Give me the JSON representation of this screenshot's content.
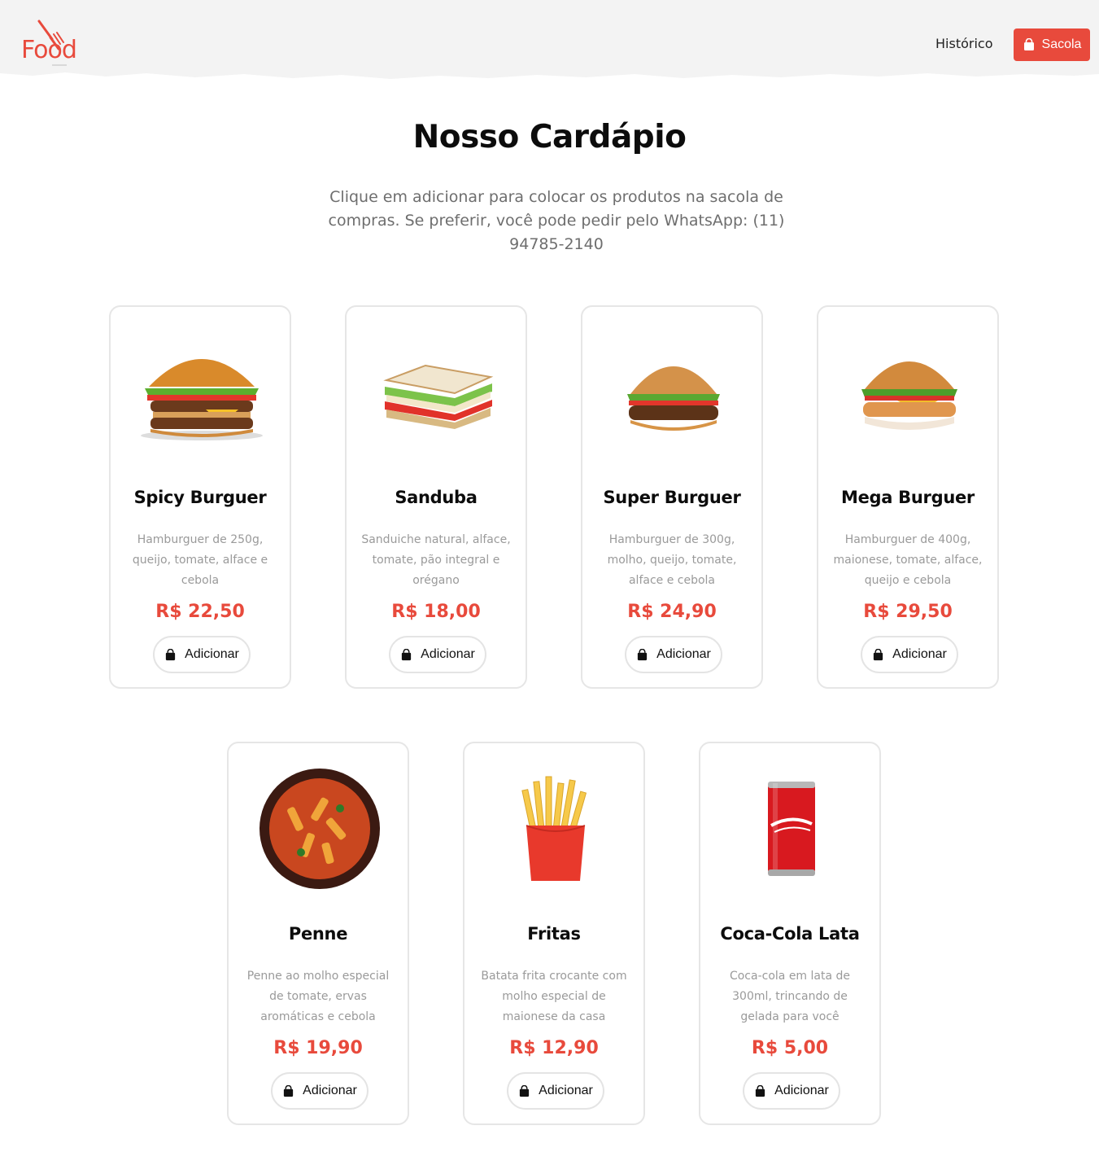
{
  "brand": {
    "logo_text": "Food",
    "accent_color": "#e84a3c"
  },
  "nav": {
    "history_label": "Histórico",
    "bag_label": "Sacola",
    "bag_icon": "shopping-bag-icon"
  },
  "menu": {
    "title": "Nosso Cardápio",
    "subtitle": "Clique em adicionar para colocar os produtos na sacola de compras. Se preferir, você pode pedir pelo WhatsApp: (11) 94785-2140"
  },
  "products": [
    {
      "name": "Spicy Burguer",
      "description": "Hamburguer de 250g, queijo, tomate, alface e cebola",
      "price": "R$ 22,50",
      "add_label": "Adicionar",
      "image": "double-burger-image"
    },
    {
      "name": "Sanduba",
      "description": "Sanduiche natural, alface, tomate, pão integral e orégano",
      "price": "R$ 18,00",
      "add_label": "Adicionar",
      "image": "sandwich-image"
    },
    {
      "name": "Super Burguer",
      "description": "Hamburguer de 300g, molho, queijo, tomate, alface e cebola",
      "price": "R$ 24,90",
      "add_label": "Adicionar",
      "image": "burger-image"
    },
    {
      "name": "Mega Burguer",
      "description": "Hamburguer de 400g, maionese, tomate, alface, queijo e cebola",
      "price": "R$ 29,50",
      "add_label": "Adicionar",
      "image": "chicken-burger-image"
    },
    {
      "name": "Penne",
      "description": "Penne ao molho especial de tomate, ervas aromáticas e cebola",
      "price": "R$ 19,90",
      "add_label": "Adicionar",
      "image": "penne-image"
    },
    {
      "name": "Fritas",
      "description": "Batata frita crocante com molho especial de maionese da casa",
      "price": "R$ 12,90",
      "add_label": "Adicionar",
      "image": "fries-image"
    },
    {
      "name": "Coca-Cola Lata",
      "description": "Coca-cola em lata de 300ml, trincando de gelada para você",
      "price": "R$ 5,00",
      "add_label": "Adicionar",
      "image": "coke-can-image"
    }
  ]
}
